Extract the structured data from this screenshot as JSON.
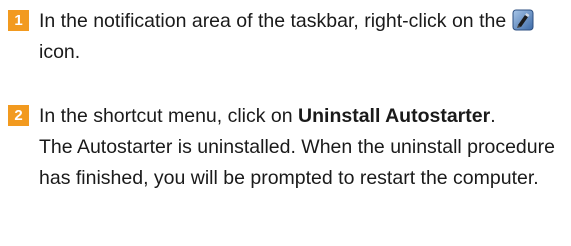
{
  "steps": [
    {
      "number": "1",
      "text_before_icon": "In the notification area of the taskbar, right-click on the",
      "icon": "autostarter-tray-icon",
      "text_after_icon": "icon."
    },
    {
      "number": "2",
      "instruction_prefix": "In the shortcut menu, click on",
      "instruction_bold": "Uninstall Autostarter",
      "instruction_suffix": ".",
      "result": "The Autostarter is uninstalled. When the uninstall procedure has finished, you will be prompted to restart the computer."
    }
  ],
  "colors": {
    "badge": "#f29a1f",
    "text": "#1a1a1a"
  }
}
